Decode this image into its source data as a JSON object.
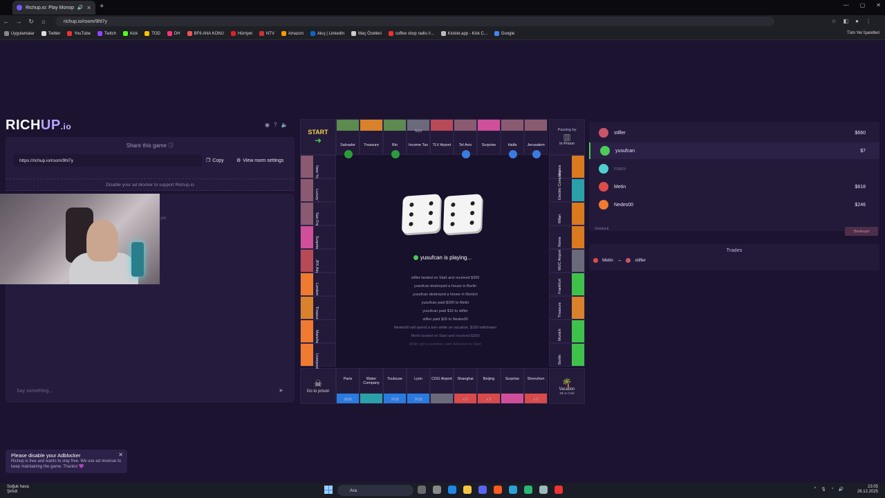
{
  "browser": {
    "tab_title": "Richup.io: Play Monopoly o",
    "url": "richup.io/room/9hl7y",
    "bookmarks": [
      "Uygulamalar",
      "Twitter",
      "YouTube",
      "Twitch",
      "Kick",
      "TOD",
      "DH",
      "BF6 ANA KONU",
      "Hürriyet",
      "NTV",
      "Amazon",
      "Akış | LinkedIn",
      "Maç Özetleri",
      "coffee shop radio //...",
      "Kicklet.app - Kick C...",
      "Google"
    ],
    "all_bookmarks": "Tüm Yer İşaretleri"
  },
  "logo": {
    "rich": "RICH",
    "up": "UP",
    "io": ".io"
  },
  "share": {
    "title": "Share this game",
    "url": "https://richup.io/room/9hl7y",
    "copy_label": "Copy",
    "settings_label": "View room settings",
    "adblock_note": "Disable your ad blocker to support Richup.io"
  },
  "chat": {
    "placeholder": "Say something...",
    "empty": "yet"
  },
  "toast": {
    "title": "Please disable your Adblocker",
    "body": "Richup is free and wants to stay free. We use ad revenue to keep maintaining the game. Thanks! 💜"
  },
  "board": {
    "start": "START",
    "top": [
      {
        "name": "Salvador",
        "color": "#5d8a4f",
        "flag": "#2a9d3a"
      },
      {
        "name": "Treasure",
        "color": "#d9822b",
        "flag": null
      },
      {
        "name": "Rio",
        "color": "#5d8a4f",
        "flag": "#2a9d3a"
      },
      {
        "name": "Income Tax",
        "color": "#6a6a7a",
        "flag": null,
        "sub": "%10"
      },
      {
        "name": "TLV Airport",
        "color": "#b84a57",
        "flag": null
      },
      {
        "name": "Tel Aviv",
        "color": "#8a5b70",
        "flag": "#3a7be0"
      },
      {
        "name": "Surprise",
        "color": "#cf4f9a",
        "flag": null
      },
      {
        "name": "Haifa",
        "color": "#8a5b70",
        "flag": "#3a7be0"
      },
      {
        "name": "Jerusalem",
        "color": "#8a5b70",
        "flag": "#3a7be0"
      }
    ],
    "passing_by": "Passing by",
    "in_prison": "In Prison",
    "left": [
      "New York",
      "Luxury Tax",
      "San Francisco",
      "Surprise",
      "JFK Airport",
      "London",
      "Treasure",
      "Manchester",
      "Liverpool"
    ],
    "right": [
      "Venice",
      "Electric Company",
      "Milan",
      "Rome",
      "MUC Airport",
      "Frankfurt",
      "Treasure",
      "Munich",
      "Berlin"
    ],
    "bottom": [
      {
        "name": "Paris",
        "price": "280$"
      },
      {
        "name": "Water Company",
        "price": ""
      },
      {
        "name": "Toulouse",
        "price": "260$"
      },
      {
        "name": "Lyon",
        "price": "260$"
      },
      {
        "name": "CDG Airport",
        "price": ""
      },
      {
        "name": "Shanghai",
        "price": "x 3"
      },
      {
        "name": "Beijing",
        "price": "x 3"
      },
      {
        "name": "Surprise",
        "price": ""
      },
      {
        "name": "Shenzhen",
        "price": "x 3"
      }
    ],
    "go_to_prison": "Go to prison",
    "vacation": "Vacation",
    "vacation_sub": "5$ on hold"
  },
  "game": {
    "current_player": "yusufcan",
    "playing_suffix": "is playing...",
    "log": [
      "stifler  landed on Start and received $300",
      "yusufcan  destroyed a house in  Berlin",
      "yusufcan  destroyed a house in  Munich",
      "yusufcan  paid $200 to  Metin",
      "yusufcan  paid $16 to  stifler",
      "stifler  paid $26 to  Nedes00",
      "Nedes00  will spend a turn while on vacation, $150 withdrawn",
      "Metin  landed on Start and received $300",
      "Metin  got a surprise card: Advance to Start"
    ]
  },
  "players": [
    {
      "name": "stifler",
      "money": "$660",
      "color": "#c9556a",
      "active": false
    },
    {
      "name": "yusufcan",
      "money": "$7",
      "color": "#4ccb55",
      "active": true
    },
    {
      "name": "mami",
      "money": "",
      "color": "#4fd0d0",
      "active": false,
      "muted": true
    },
    {
      "name": "Metin",
      "money": "$818",
      "color": "#e04a4a",
      "active": false
    },
    {
      "name": "Nedes00",
      "money": "$246",
      "color": "#f07a30",
      "active": false
    }
  ],
  "votekick": "Votekick",
  "bankrupt": "Bankrupt",
  "trades": {
    "title": "Trades",
    "from": "Metin",
    "to": "stifler"
  },
  "taskbar": {
    "weather_title": "Soğuk hava",
    "weather_sub": "Şimdi",
    "search": "Ara",
    "time": "23:05",
    "date": "28.12.2025"
  }
}
